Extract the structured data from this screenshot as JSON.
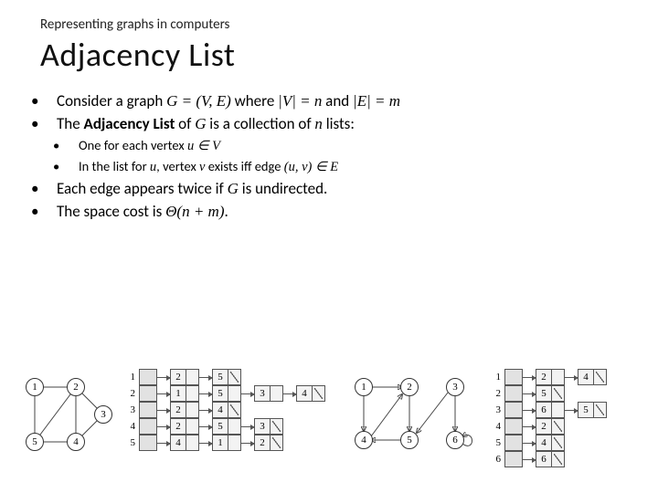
{
  "subtitle": "Representing graphs in computers",
  "title": "Adjacency List",
  "bullets": {
    "b1_a": "Consider a graph ",
    "b1_b": "G = (V, E)",
    "b1_c": " where ",
    "b1_d": "|V| = n",
    "b1_e": " and ",
    "b1_f": "|E| = m",
    "b2_a": "The ",
    "b2_b": "Adjacency List",
    "b2_c": " of ",
    "b2_d": "G",
    "b2_e": " is a collection of ",
    "b2_f": "n",
    "b2_g": " lists:",
    "b2s1_a": "One for each vertex ",
    "b2s1_b": "u ∈ V",
    "b2s2_a": "In the list for ",
    "b2s2_b": "u",
    "b2s2_c": ", vertex ",
    "b2s2_d": "v",
    "b2s2_e": " exists iff edge ",
    "b2s2_f": "(u, v) ∈ E",
    "b3_a": "Each edge appears twice if ",
    "b3_b": "G",
    "b3_c": " is undirected.",
    "b4_a": "The space cost is ",
    "b4_b": "Θ(n + m)",
    "b4_c": "."
  },
  "graph1": {
    "nodes": [
      "1",
      "2",
      "3",
      "4",
      "5"
    ],
    "edges_undirected": [
      [
        1,
        2
      ],
      [
        1,
        5
      ],
      [
        2,
        5
      ],
      [
        2,
        3
      ],
      [
        2,
        4
      ],
      [
        3,
        4
      ],
      [
        4,
        5
      ]
    ],
    "adj": {
      "1": [
        "2",
        "5"
      ],
      "2": [
        "1",
        "5",
        "3",
        "4"
      ],
      "3": [
        "2",
        "4"
      ],
      "4": [
        "2",
        "5",
        "3"
      ],
      "5": [
        "4",
        "1",
        "2"
      ]
    }
  },
  "graph2": {
    "nodes": [
      "1",
      "2",
      "3",
      "4",
      "5",
      "6"
    ],
    "edges_directed": [
      [
        1,
        2
      ],
      [
        1,
        4
      ],
      [
        4,
        2
      ],
      [
        2,
        5
      ],
      [
        5,
        4
      ],
      [
        3,
        5
      ],
      [
        3,
        6
      ],
      [
        6,
        6
      ]
    ],
    "adj": {
      "1": [
        "2",
        "4"
      ],
      "2": [
        "5"
      ],
      "3": [
        "6",
        "5"
      ],
      "4": [
        "2"
      ],
      "5": [
        "4"
      ],
      "6": [
        "6"
      ]
    }
  }
}
